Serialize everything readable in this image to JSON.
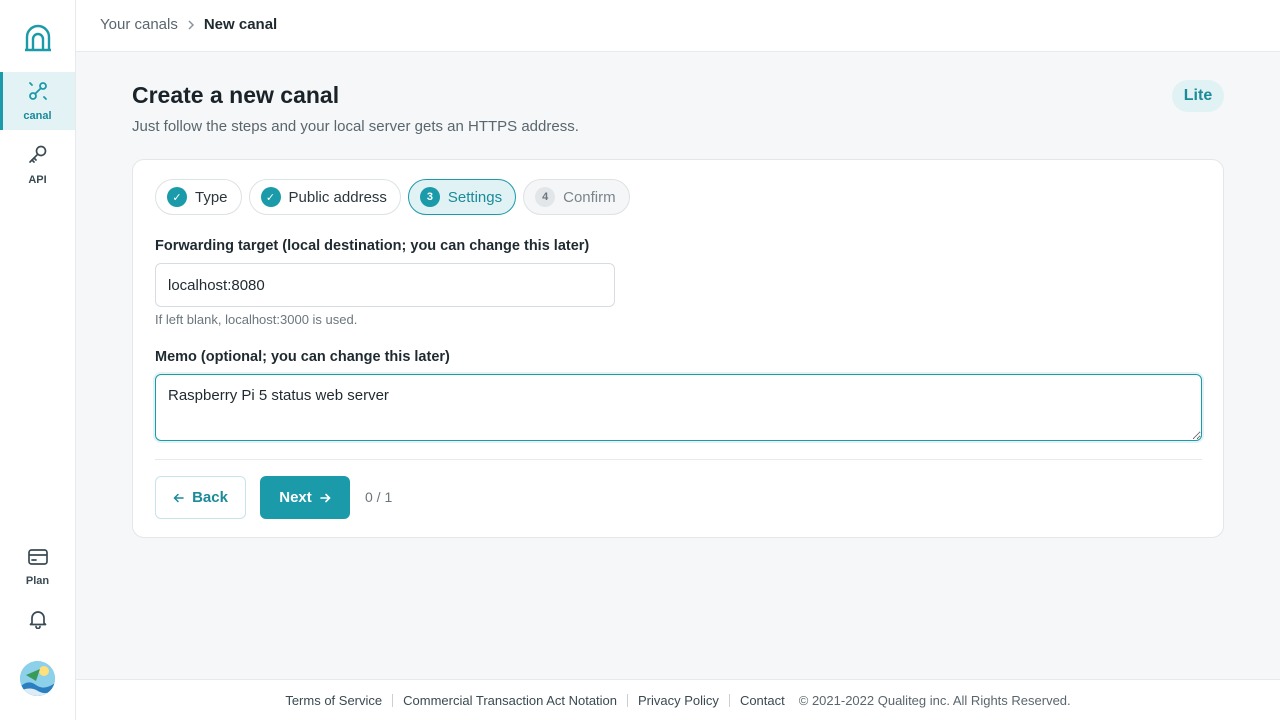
{
  "sidebar": {
    "logo_icon": "arch-logo-icon",
    "items": [
      {
        "label": "canal",
        "icon": "link-icon",
        "active": true
      },
      {
        "label": "API",
        "icon": "key-icon",
        "active": false
      },
      {
        "label": "Plan",
        "icon": "credit-card-icon",
        "active": false
      }
    ],
    "notifications_icon": "bell-icon",
    "avatar_icon": "avatar"
  },
  "header": {
    "breadcrumb": {
      "parent": "Your canals",
      "current": "New canal"
    }
  },
  "main": {
    "title": "Create a new canal",
    "subtitle": "Just follow the steps and your local server gets an HTTPS address.",
    "plan_badge": "Lite",
    "steps": [
      {
        "number": "✓",
        "label": "Type",
        "state": "done"
      },
      {
        "number": "✓",
        "label": "Public address",
        "state": "done"
      },
      {
        "number": "3",
        "label": "Settings",
        "state": "current"
      },
      {
        "number": "4",
        "label": "Confirm",
        "state": "pending"
      }
    ],
    "forwarding": {
      "label": "Forwarding target (local destination; you can change this later)",
      "value": "localhost:8080",
      "hint": "If left blank, localhost:3000 is used."
    },
    "memo": {
      "label": "Memo (optional; you can change this later)",
      "value": "Raspberry Pi 5 status web server"
    },
    "actions": {
      "back_label": "Back",
      "next_label": "Next",
      "counter": "0 / 1"
    }
  },
  "footer": {
    "links": [
      "Terms of Service",
      "Commercial Transaction Act Notation",
      "Privacy Policy",
      "Contact"
    ],
    "copyright": "© 2021-2022 Qualiteg inc. All Rights Reserved."
  },
  "colors": {
    "accent": "#1b9aaa",
    "accent_light": "#e0f2f4",
    "text": "#1f2a30",
    "muted": "#5a666d"
  }
}
